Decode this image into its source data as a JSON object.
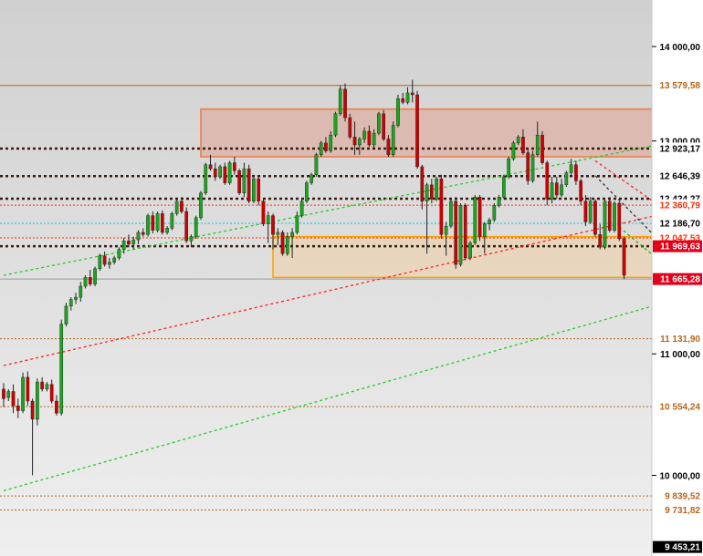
{
  "colors": {
    "up": "#19a81c",
    "down": "#d10000",
    "background_top": "#d2d2d2",
    "background_bottom": "#ececec",
    "axis_bg": "#ffffff"
  },
  "chart_data": {
    "type": "candlestick",
    "title": "",
    "y_scale": "log",
    "ylim": [
      9400,
      14500
    ],
    "y_ticks": [
      {
        "value": 14000,
        "label": "14 000,00"
      },
      {
        "value": 13000,
        "label": "13 000,00"
      },
      {
        "value": 11000,
        "label": "11 000,00"
      },
      {
        "value": 10000,
        "label": "10 000,00"
      }
    ],
    "horizontal_levels": [
      {
        "value": 13579.58,
        "label": "13 579,58",
        "style": "solid",
        "color": "#b5651d",
        "label_bg": "#ffffff",
        "label_color": "#b5651d"
      },
      {
        "value": 12923.17,
        "label": "12 923,17",
        "style": "dotted",
        "color": "#3a1a10",
        "label_bg": "#ffffff",
        "label_color": "#000000"
      },
      {
        "value": 12646.39,
        "label": "12 646,39",
        "style": "dotted",
        "color": "#3a1a10",
        "label_bg": "#ffffff",
        "label_color": "#000000"
      },
      {
        "value": 12424.27,
        "label": "12 424,27",
        "style": "dotted",
        "color": "#3a1a10",
        "label_bg": "#ffffff",
        "label_color": "#000000"
      },
      {
        "value": 12360.79,
        "label": "12 360,79",
        "style": "dotted",
        "color": "#ff2a00",
        "label_bg": "#ffffff",
        "label_color": "#ff2a00"
      },
      {
        "value": 12186.7,
        "label": "12 186,70",
        "style": "dotted",
        "color": "#00c8e6",
        "label_bg": "#ffffff",
        "label_color": "#000000"
      },
      {
        "value": 12047.53,
        "label": "12 047,53",
        "style": "dotted",
        "color": "#ff2a00",
        "label_bg": "#ffffff",
        "label_color": "#ff2a00"
      },
      {
        "value": 11969.63,
        "label": "11 969,63",
        "style": "dotted",
        "color": "#3a1a10",
        "label_bg": "#e0001a",
        "label_color": "#ffffff"
      },
      {
        "value": 11665.28,
        "label": "11 665,28",
        "style": "solid",
        "color": "#9a9a9a",
        "label_bg": "#e0001a",
        "label_color": "#ffffff"
      },
      {
        "value": 11131.9,
        "label": "11 131,90",
        "style": "dotted",
        "color": "#b5651d",
        "label_bg": "#ffffff",
        "label_color": "#b5651d"
      },
      {
        "value": 10554.24,
        "label": "10 554,24",
        "style": "dotted",
        "color": "#b5651d",
        "label_bg": "#ffffff",
        "label_color": "#b5651d"
      },
      {
        "value": 9839.52,
        "label": "9 839,52",
        "style": "dotted",
        "color": "#b5651d",
        "label_bg": "#ffffff",
        "label_color": "#b5651d"
      },
      {
        "value": 9731.82,
        "label": "9 731,82",
        "style": "dotted",
        "color": "#b5651d",
        "label_bg": "#ffffff",
        "label_color": "#b5651d"
      },
      {
        "value": 9453.21,
        "label": "9 453,21",
        "style": "none",
        "color": "#000000",
        "label_bg": "#000000",
        "label_color": "#ffffff"
      }
    ],
    "zones": [
      {
        "name": "resistance-zone",
        "from_index": 41,
        "to_index": 140,
        "low": 12840,
        "high": 13330,
        "fill": "rgba(225,110,80,0.28)",
        "stroke": "#e87a4a"
      },
      {
        "name": "support-zone",
        "from_index": 56,
        "to_index": 140,
        "low": 11680,
        "high": 12060,
        "fill": "rgba(245,200,140,0.40)",
        "stroke": "#ffa000"
      }
    ],
    "trendlines": [
      {
        "name": "green-upper",
        "x1": 0,
        "y1": 11700,
        "x2": 143,
        "y2": 13030,
        "color": "#22cc22",
        "dash": "3,3"
      },
      {
        "name": "green-lower",
        "x1": 0,
        "y1": 9880,
        "x2": 143,
        "y2": 11520,
        "color": "#22cc22",
        "dash": "3,3"
      },
      {
        "name": "red-trend",
        "x1": 0,
        "y1": 10900,
        "x2": 143,
        "y2": 12340,
        "color": "#ff2020",
        "dash": "3,3"
      },
      {
        "name": "red-down",
        "x1": 123,
        "y1": 12800,
        "x2": 143,
        "y2": 12140,
        "color": "#ff2020",
        "dash": "3,3"
      },
      {
        "name": "dark-down",
        "x1": 123,
        "y1": 12650,
        "x2": 143,
        "y2": 11720,
        "color": "#333333",
        "dash": "3,3"
      },
      {
        "name": "green-down",
        "x1": 128,
        "y1": 12150,
        "x2": 143,
        "y2": 11590,
        "color": "#22aa22",
        "dash": "3,3"
      }
    ],
    "candles": [
      [
        10700,
        10750,
        10550,
        10620
      ],
      [
        10630,
        10700,
        10600,
        10680
      ],
      [
        10680,
        10740,
        10500,
        10560
      ],
      [
        10560,
        10620,
        10460,
        10520
      ],
      [
        10520,
        10840,
        10500,
        10800
      ],
      [
        10800,
        10850,
        10560,
        10600
      ],
      [
        10600,
        10620,
        10000,
        10450
      ],
      [
        10450,
        10790,
        10400,
        10760
      ],
      [
        10760,
        10800,
        10680,
        10700
      ],
      [
        10700,
        10760,
        10680,
        10740
      ],
      [
        10740,
        10780,
        10580,
        10600
      ],
      [
        10600,
        10650,
        10480,
        10500
      ],
      [
        10500,
        11300,
        10480,
        11260
      ],
      [
        11260,
        11450,
        11240,
        11420
      ],
      [
        11420,
        11500,
        11380,
        11480
      ],
      [
        11480,
        11540,
        11440,
        11500
      ],
      [
        11500,
        11640,
        11460,
        11600
      ],
      [
        11600,
        11700,
        11580,
        11680
      ],
      [
        11680,
        11750,
        11600,
        11620
      ],
      [
        11620,
        11780,
        11600,
        11760
      ],
      [
        11760,
        11900,
        11740,
        11880
      ],
      [
        11880,
        11920,
        11780,
        11800
      ],
      [
        11800,
        11860,
        11760,
        11820
      ],
      [
        11820,
        11880,
        11800,
        11860
      ],
      [
        11860,
        11960,
        11840,
        11940
      ],
      [
        11940,
        12050,
        11900,
        12020
      ],
      [
        12020,
        12080,
        11960,
        11990
      ],
      [
        11990,
        12060,
        11940,
        12030
      ],
      [
        12030,
        12120,
        11990,
        12100
      ],
      [
        12100,
        12140,
        12060,
        12080
      ],
      [
        12080,
        12280,
        12060,
        12260
      ],
      [
        12260,
        12300,
        12090,
        12120
      ],
      [
        12120,
        12300,
        12100,
        12280
      ],
      [
        12280,
        12310,
        12080,
        12100
      ],
      [
        12100,
        12160,
        12080,
        12140
      ],
      [
        12140,
        12300,
        12120,
        12280
      ],
      [
        12280,
        12420,
        12260,
        12400
      ],
      [
        12400,
        12440,
        12280,
        12300
      ],
      [
        12300,
        12340,
        12000,
        12020
      ],
      [
        12020,
        12080,
        11960,
        12060
      ],
      [
        12060,
        12260,
        12040,
        12240
      ],
      [
        12240,
        12500,
        12220,
        12480
      ],
      [
        12480,
        12780,
        12460,
        12760
      ],
      [
        12760,
        12860,
        12700,
        12720
      ],
      [
        12720,
        12780,
        12600,
        12640
      ],
      [
        12640,
        12760,
        12620,
        12740
      ],
      [
        12740,
        12780,
        12560,
        12580
      ],
      [
        12580,
        12800,
        12560,
        12780
      ],
      [
        12780,
        12840,
        12660,
        12700
      ],
      [
        12700,
        12720,
        12460,
        12480
      ],
      [
        12480,
        12780,
        12440,
        12720
      ],
      [
        12720,
        12760,
        12380,
        12400
      ],
      [
        12400,
        12660,
        12380,
        12620
      ],
      [
        12620,
        12640,
        12360,
        12400
      ],
      [
        12400,
        12420,
        12160,
        12180
      ],
      [
        12180,
        12300,
        12000,
        12260
      ],
      [
        12260,
        12280,
        11940,
        12080
      ],
      [
        12080,
        12140,
        11980,
        12100
      ],
      [
        12100,
        12120,
        11880,
        11900
      ],
      [
        11900,
        12100,
        11880,
        12060
      ],
      [
        12060,
        12140,
        11860,
        12100
      ],
      [
        12100,
        12300,
        12080,
        12260
      ],
      [
        12260,
        12420,
        12240,
        12400
      ],
      [
        12400,
        12600,
        12380,
        12580
      ],
      [
        12580,
        12680,
        12560,
        12660
      ],
      [
        12660,
        12880,
        12640,
        12860
      ],
      [
        12860,
        13000,
        12840,
        12980
      ],
      [
        12980,
        13040,
        12880,
        12900
      ],
      [
        12900,
        13100,
        12880,
        13060
      ],
      [
        13060,
        13300,
        13040,
        13280
      ],
      [
        13280,
        13580,
        13260,
        13540
      ],
      [
        13540,
        13600,
        13200,
        13240
      ],
      [
        13240,
        13280,
        13020,
        13040
      ],
      [
        13040,
        13200,
        12860,
        12960
      ],
      [
        12960,
        13040,
        12860,
        13020
      ],
      [
        13020,
        13140,
        12980,
        13100
      ],
      [
        13100,
        13160,
        12940,
        12960
      ],
      [
        12960,
        13120,
        12920,
        13080
      ],
      [
        13080,
        13300,
        13060,
        13280
      ],
      [
        13280,
        13320,
        13000,
        13020
      ],
      [
        13020,
        13060,
        12840,
        12860
      ],
      [
        12860,
        13200,
        12840,
        13160
      ],
      [
        13160,
        13480,
        13140,
        13440
      ],
      [
        13440,
        13500,
        13380,
        13400
      ],
      [
        13400,
        13560,
        13380,
        13500
      ],
      [
        13500,
        13640,
        13400,
        13480
      ],
      [
        13480,
        13520,
        12720,
        12740
      ],
      [
        12740,
        12760,
        12320,
        12400
      ],
      [
        12400,
        12580,
        11900,
        12560
      ],
      [
        12560,
        12620,
        12380,
        12420
      ],
      [
        12420,
        12640,
        12400,
        12620
      ],
      [
        12620,
        12660,
        12040,
        12080
      ],
      [
        12080,
        12200,
        11880,
        12160
      ],
      [
        12160,
        12420,
        12140,
        12400
      ],
      [
        12400,
        12440,
        11760,
        11800
      ],
      [
        11800,
        12380,
        11780,
        12360
      ],
      [
        12360,
        12380,
        11840,
        11860
      ],
      [
        11860,
        12020,
        11840,
        12000
      ],
      [
        12000,
        12460,
        11980,
        12440
      ],
      [
        12440,
        12460,
        12020,
        12060
      ],
      [
        12060,
        12200,
        11900,
        12180
      ],
      [
        12180,
        12240,
        12120,
        12220
      ],
      [
        12220,
        12380,
        12200,
        12360
      ],
      [
        12360,
        12460,
        12340,
        12440
      ],
      [
        12440,
        12660,
        12420,
        12640
      ],
      [
        12640,
        12840,
        12620,
        12820
      ],
      [
        12820,
        13000,
        12800,
        12980
      ],
      [
        12980,
        13060,
        12960,
        13040
      ],
      [
        13040,
        13120,
        12860,
        12880
      ],
      [
        12880,
        12920,
        12560,
        12600
      ],
      [
        12600,
        12900,
        12580,
        12860
      ],
      [
        12860,
        13200,
        12840,
        13060
      ],
      [
        13060,
        13100,
        12760,
        12780
      ],
      [
        12780,
        12800,
        12360,
        12420
      ],
      [
        12420,
        12640,
        12380,
        12580
      ],
      [
        12580,
        12640,
        12420,
        12460
      ],
      [
        12460,
        12620,
        12440,
        12560
      ],
      [
        12560,
        12700,
        12540,
        12680
      ],
      [
        12680,
        12820,
        12640,
        12760
      ],
      [
        12760,
        12800,
        12560,
        12600
      ],
      [
        12600,
        12620,
        12360,
        12400
      ],
      [
        12400,
        12460,
        12160,
        12200
      ],
      [
        12200,
        12440,
        12180,
        12400
      ],
      [
        12400,
        12420,
        12060,
        12080
      ],
      [
        12080,
        12180,
        11940,
        11960
      ],
      [
        11960,
        12420,
        11940,
        12400
      ],
      [
        12400,
        12440,
        12100,
        12120
      ],
      [
        12120,
        12400,
        12100,
        12380
      ],
      [
        12380,
        12400,
        12020,
        12040
      ],
      [
        12040,
        12060,
        11665,
        11700
      ]
    ]
  }
}
